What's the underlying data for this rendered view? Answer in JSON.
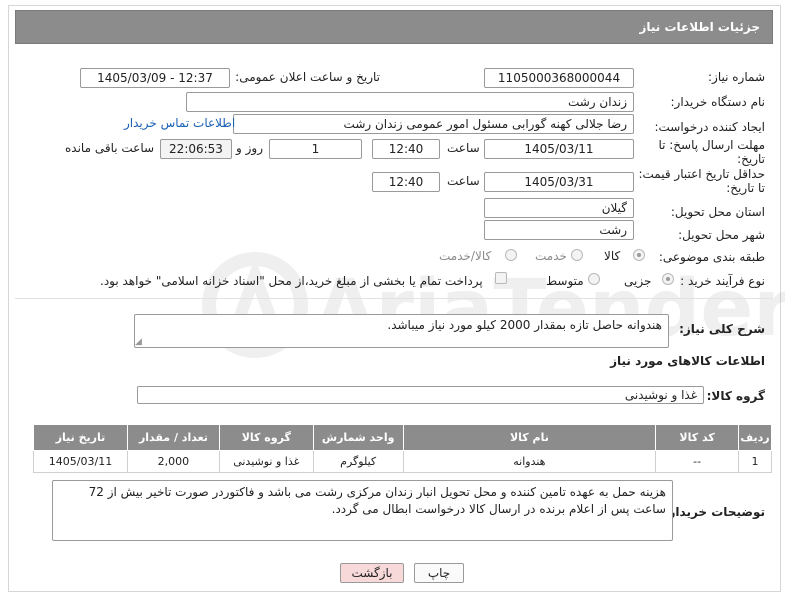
{
  "header": {
    "title": "جزئیات اطلاعات نیاز"
  },
  "fields": {
    "need_number_label": "شماره نیاز:",
    "need_number": "1105000368000044",
    "announce_label": "تاریخ و ساعت اعلان عمومی:",
    "announce_value": "1405/03/09 - 12:37",
    "buyer_org_label": "نام دستگاه خریدار:",
    "buyer_org": "زندان رشت",
    "creator_label": "ایجاد کننده درخواست:",
    "creator": "رضا جلالی کهنه گورابی مسئول امور عمومی زندان رشت",
    "contact_link": "اطلاعات تماس خریدار",
    "deadline_label_1": "مهلت ارسال پاسخ: تا",
    "deadline_label_2": "تاریخ:",
    "deadline_date": "1405/03/11",
    "time_label": "ساعت",
    "deadline_time": "12:40",
    "days_value": "1",
    "days_label": "روز و",
    "remaining_time": "22:06:53",
    "remaining_label": "ساعت باقی مانده",
    "price_label_1": "حداقل تاریخ اعتبار قیمت:",
    "price_label_2": "تا تاریخ:",
    "price_date": "1405/03/31",
    "price_time": "12:40",
    "province_label": "استان محل تحویل:",
    "province": "گیلان",
    "city_label": "شهر محل تحویل:",
    "city": "رشت",
    "category_label": "طبقه بندی موضوعی:",
    "category_options": [
      "کالا",
      "خدمت",
      "کالا/خدمت"
    ],
    "process_label": "نوع فرآیند خرید :",
    "process_options": [
      "جزیی",
      "متوسط"
    ],
    "payment_note": "پرداخت تمام یا بخشی از مبلغ خرید،از محل \"اسناد خزانه اسلامی\" خواهد بود.",
    "description_label": "شرح کلی نیاز:",
    "description": "هندوانه حاصل تازه بمقدار 2000 کیلو مورد نیاز میباشد.",
    "goods_info_title": "اطلاعات کالاهای مورد نیاز",
    "goods_group_label": "گروه کالا:",
    "goods_group": "غذا و نوشیدنی"
  },
  "table": {
    "headers": [
      "ردیف",
      "کد کالا",
      "نام کالا",
      "واحد شمارش",
      "گروه کالا",
      "تعداد / مقدار",
      "تاریخ نیاز"
    ],
    "rows": [
      [
        "1",
        "--",
        "هندوانه",
        "کیلوگرم",
        "غذا و نوشیدنی",
        "2,000",
        "1405/03/11"
      ]
    ]
  },
  "buyer_notes": {
    "label": "توضیحات خریدار:",
    "text": "هزینه حمل به عهده تامین کننده و محل تحویل انبار زندان مرکزی رشت می باشد و فاکتوردر صورت تاخیر بیش از 72 ساعت پس از اعلام برنده در ارسال کالا درخواست ابطال می گردد."
  },
  "buttons": {
    "print": "چاپ",
    "back": "بازگشت"
  },
  "watermark": "AriaTender.net",
  "colors": {
    "header_bg": "#8c8c8c",
    "link": "#1a5fb4",
    "back_button_bg": "#f7d9d9"
  }
}
